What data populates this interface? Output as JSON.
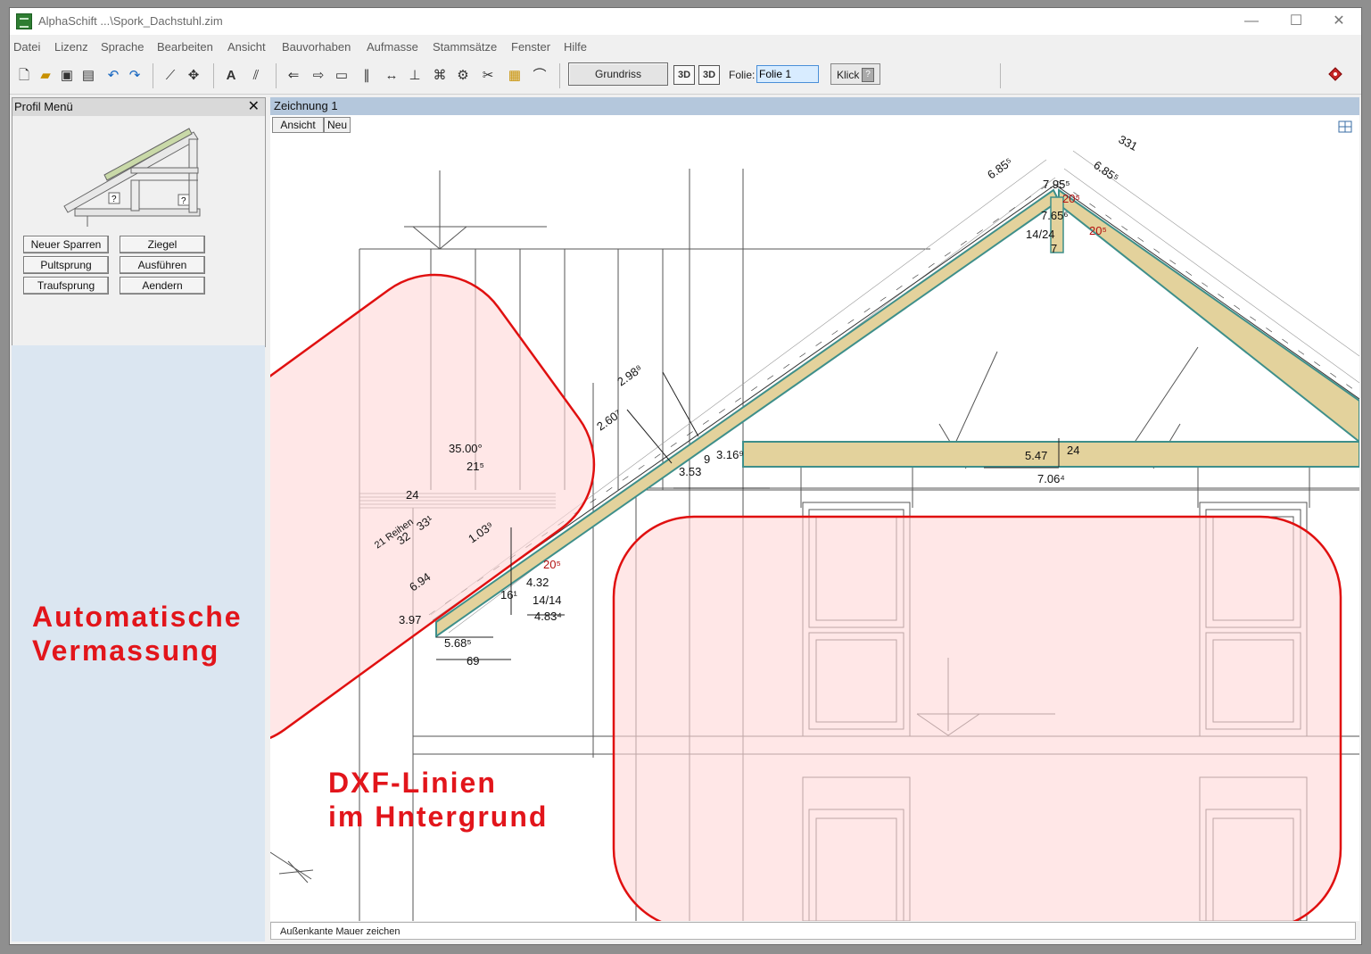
{
  "window": {
    "title": "AlphaSchift ...\\Spork_Dachstuhl.zim",
    "minimize": "—",
    "maximize": "☐",
    "close": "✕"
  },
  "menu": [
    "Datei",
    "Lizenz",
    "Sprache",
    "Bearbeiten",
    "Ansicht",
    "Bauvorhaben",
    "Aufmasse",
    "Stammsätze",
    "Fenster",
    "Hilfe"
  ],
  "toolbar": {
    "grundriss": "Grundriss",
    "btn_3d_a": "3D",
    "btn_3d_b": "3D",
    "folie_label": "Folie:",
    "folie_value": "Folie 1",
    "klick": "Klick",
    "klick_help": "?",
    "icons": [
      "new-file-icon",
      "open-folder-icon",
      "save-icon",
      "print-icon",
      "undo-icon",
      "redo-icon",
      "line-tool-icon",
      "move-tool-icon",
      "text-tool-icon",
      "hatch-tool-icon",
      "arrow-tool-icon",
      "double-arrow-icon",
      "rectangle-icon",
      "parallel-icon",
      "dimension-icon",
      "level-icon",
      "beam-icon",
      "gear-icon",
      "scissors-icon",
      "layers-icon",
      "polyline-icon"
    ]
  },
  "profil": {
    "title": "Profil Menü",
    "close": "✕",
    "buttons": [
      "Neuer Sparren",
      "Ziegel",
      "Pultsprung",
      "Ausführen",
      "Traufsprung",
      "Aendern"
    ],
    "help_marks": [
      "?",
      "?"
    ]
  },
  "annotations": {
    "auto_1": "Automatische",
    "auto_2": "Vermassung",
    "dxf_1": "DXF-Linien",
    "dxf_2": "im Hntergrund"
  },
  "document": {
    "title": "Zeichnung 1",
    "tab_ansicht": "Ansicht",
    "tab_neu": "Neu",
    "dims": {
      "d_331": "331",
      "d_685a": "6.85⁵",
      "d_685b": "6.85⁵",
      "d_795": "7.95⁵",
      "d_765": "7.65⁶",
      "d_1424a": "14/24",
      "d_205a": "20⁵",
      "d_205b": "20⁵",
      "d_7": "7",
      "d_298": "2.98⁸",
      "d_260": "2.60⁷",
      "d_3500": "35.00°",
      "d_215": "21⁵",
      "d_24a": "24",
      "d_316": "3.16⁹",
      "d_353": "3.53",
      "d_92": "9",
      "d_547": "5.47",
      "d_24b": "24",
      "d_706": "7.06⁴",
      "d_21reihen": "21 Reihen",
      "d_32": "32",
      "d_331b": "33¹",
      "d_103": "1.03⁹",
      "d_694": "6.94",
      "d_205c": "20⁵",
      "d_432": "4.32",
      "d_161": "16¹",
      "d_1414": "14/14",
      "d_483": "4.83⁴",
      "d_397": "3.97",
      "d_568": "5.68⁵",
      "d_69": "69"
    }
  },
  "status": {
    "text": "Außenkante Mauer zeichen"
  },
  "colors": {
    "highlight_fill": "#ffd9d9",
    "highlight_stroke": "#e01010",
    "timber": "#e3d29c",
    "timber_edge": "#3e8f8a",
    "annotation": "#e2151b",
    "dim_red": "#b31010"
  }
}
